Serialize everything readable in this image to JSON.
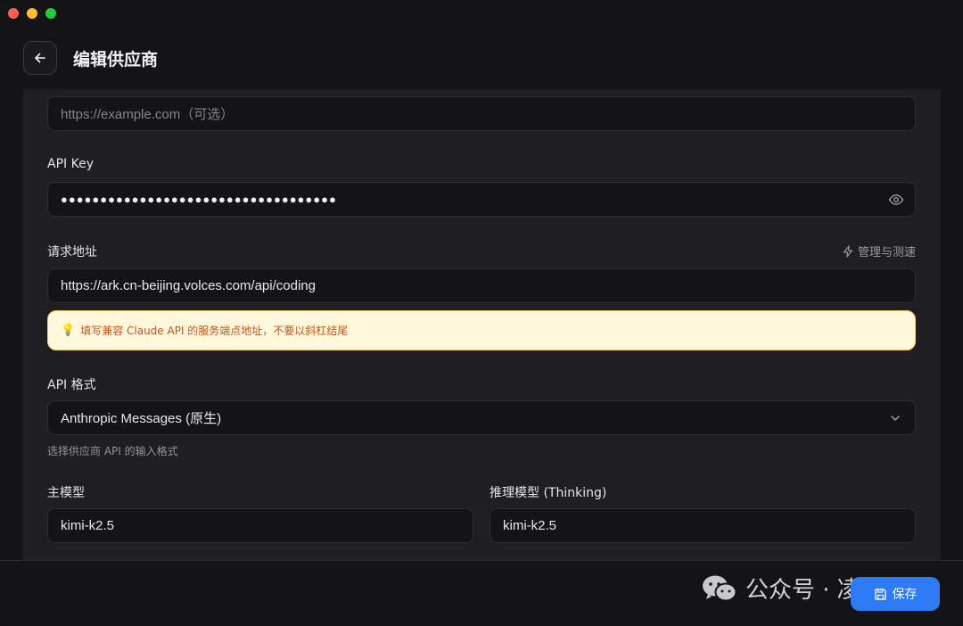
{
  "window": {
    "traffic_lights": {
      "close": "#fe5f57",
      "minimize": "#febc2e",
      "maximize": "#28c840"
    }
  },
  "header": {
    "title": "编辑供应商",
    "back_icon": "arrow-left-icon"
  },
  "form": {
    "website": {
      "placeholder": "https://example.com（可选）",
      "value": ""
    },
    "api_key": {
      "label": "API Key",
      "value": "●●●●●●●●●●●●●●●●●●●●●●●●●●●●●●●●●●●",
      "icon": "eye-icon"
    },
    "endpoint": {
      "label": "请求地址",
      "manage_label": "管理与测速",
      "manage_icon": "lightning-icon",
      "value": "https://ark.cn-beijing.volces.com/api/coding",
      "tip": "填写兼容 Claude API 的服务端点地址，不要以斜杠结尾",
      "tip_icon": "lightbulb-icon"
    },
    "api_format": {
      "label": "API 格式",
      "selected": "Anthropic Messages (原生)",
      "hint": "选择供应商 API 的输入格式",
      "icon": "chevron-down-icon"
    },
    "main_model": {
      "label": "主模型",
      "value": "kimi-k2.5"
    },
    "reasoning_model": {
      "label": "推理模型 (Thinking)",
      "value": "kimi-k2.5"
    }
  },
  "footer": {
    "watermark": "公众号 · 凌小添",
    "save_label": "保存",
    "save_icon": "save-icon"
  },
  "colors": {
    "accent": "#2f7bf6",
    "tip_bg": "#fff8dc",
    "tip_text": "#c0571a"
  }
}
